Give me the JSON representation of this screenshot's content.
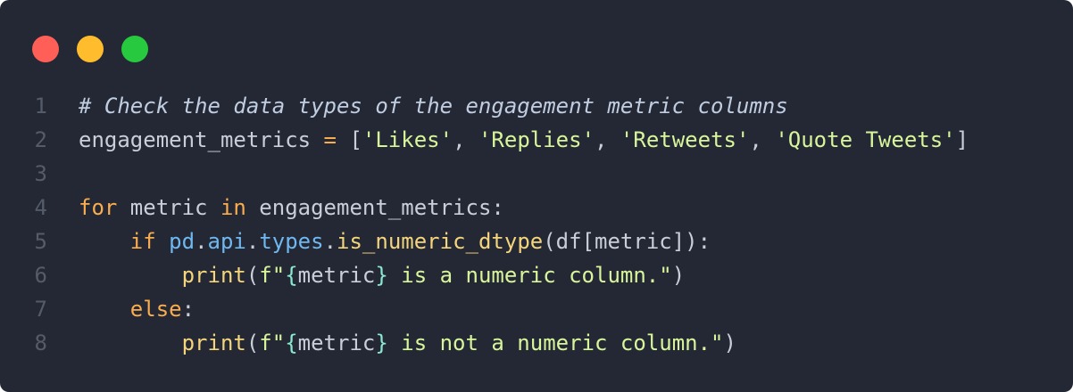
{
  "theme": {
    "background": "#232834",
    "dot_colors": [
      "#ff5f56",
      "#ffbd2e",
      "#27c93f"
    ],
    "colors": {
      "comment": "#c0cde0",
      "plain": "#c9ced8",
      "string": "#d9f59b",
      "keyword": "#f9ad4f",
      "operator": "#f9ad4f",
      "attribute": "#6fb8f0",
      "function": "#f5d57c",
      "punct": "#c9ced8",
      "brace": "#8ce8d0",
      "linenum": "#555b68"
    }
  },
  "window_controls": [
    {
      "name": "close-dot",
      "label": ""
    },
    {
      "name": "minimize-dot",
      "label": ""
    },
    {
      "name": "maximize-dot",
      "label": ""
    }
  ],
  "lines": [
    {
      "n": "1",
      "tokens": [
        {
          "t": "# Check the data types of the engagement metric columns",
          "k": "comment"
        }
      ]
    },
    {
      "n": "2",
      "tokens": [
        {
          "t": "engagement_metrics ",
          "k": "plain"
        },
        {
          "t": "=",
          "k": "operator"
        },
        {
          "t": " [",
          "k": "plain"
        },
        {
          "t": "'Likes'",
          "k": "string"
        },
        {
          "t": ", ",
          "k": "plain"
        },
        {
          "t": "'Replies'",
          "k": "string"
        },
        {
          "t": ", ",
          "k": "plain"
        },
        {
          "t": "'Retweets'",
          "k": "string"
        },
        {
          "t": ", ",
          "k": "plain"
        },
        {
          "t": "'Quote Tweets'",
          "k": "string"
        },
        {
          "t": "]",
          "k": "plain"
        }
      ]
    },
    {
      "n": "3",
      "tokens": []
    },
    {
      "n": "4",
      "tokens": [
        {
          "t": "for",
          "k": "keyword"
        },
        {
          "t": " metric ",
          "k": "plain"
        },
        {
          "t": "in",
          "k": "keyword"
        },
        {
          "t": " engagement_metrics:",
          "k": "plain"
        }
      ]
    },
    {
      "n": "5",
      "tokens": [
        {
          "t": "    ",
          "k": "plain"
        },
        {
          "t": "if",
          "k": "keyword"
        },
        {
          "t": " ",
          "k": "plain"
        },
        {
          "t": "pd",
          "k": "attribute"
        },
        {
          "t": ".",
          "k": "plain"
        },
        {
          "t": "api",
          "k": "attribute"
        },
        {
          "t": ".",
          "k": "plain"
        },
        {
          "t": "types",
          "k": "attribute"
        },
        {
          "t": ".",
          "k": "plain"
        },
        {
          "t": "is_numeric_dtype",
          "k": "function"
        },
        {
          "t": "(df[metric]):",
          "k": "plain"
        }
      ]
    },
    {
      "n": "6",
      "tokens": [
        {
          "t": "        ",
          "k": "plain"
        },
        {
          "t": "print",
          "k": "function"
        },
        {
          "t": "(",
          "k": "plain"
        },
        {
          "t": "f\"",
          "k": "string"
        },
        {
          "t": "{",
          "k": "brace"
        },
        {
          "t": "metric",
          "k": "plain"
        },
        {
          "t": "}",
          "k": "brace"
        },
        {
          "t": " is a numeric column.\"",
          "k": "string"
        },
        {
          "t": ")",
          "k": "plain"
        }
      ]
    },
    {
      "n": "7",
      "tokens": [
        {
          "t": "    ",
          "k": "plain"
        },
        {
          "t": "else",
          "k": "keyword"
        },
        {
          "t": ":",
          "k": "plain"
        }
      ]
    },
    {
      "n": "8",
      "tokens": [
        {
          "t": "        ",
          "k": "plain"
        },
        {
          "t": "print",
          "k": "function"
        },
        {
          "t": "(",
          "k": "plain"
        },
        {
          "t": "f\"",
          "k": "string"
        },
        {
          "t": "{",
          "k": "brace"
        },
        {
          "t": "metric",
          "k": "plain"
        },
        {
          "t": "}",
          "k": "brace"
        },
        {
          "t": " is not a numeric column.\"",
          "k": "string"
        },
        {
          "t": ")",
          "k": "plain"
        }
      ]
    }
  ]
}
